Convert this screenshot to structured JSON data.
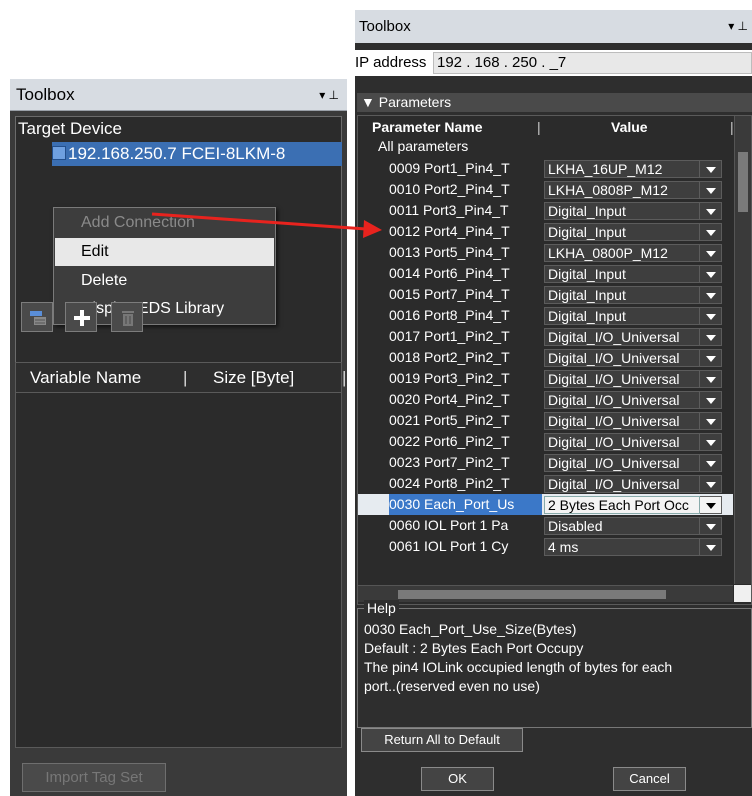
{
  "left_panel": {
    "title": "Toolbox",
    "pin_glyphs": "▾ ⊥",
    "target_label": "Target Device",
    "device": "192.168.250.7   FCEI-8LKM-8",
    "context_menu": [
      "Add Connection",
      "Edit",
      "Delete",
      "Display EDS Library"
    ],
    "variable_columns": {
      "name": "Variable Name",
      "size": "Size [Byte]",
      "sep": "|"
    },
    "import_label": "Import Tag Set"
  },
  "right_panel": {
    "title": "Toolbox",
    "pin_glyphs": "▾ ⊥",
    "ip_label": "IP address",
    "ip_value": "192 . 168 . 250 . _7",
    "params_header": "▼ Parameters",
    "col_name": "Parameter Name",
    "col_value": "Value",
    "col_sep": "|",
    "group": "All parameters",
    "rows": [
      {
        "name": "0009 Port1_Pin4_T",
        "value": "LKHA_16UP_M12"
      },
      {
        "name": "0010 Port2_Pin4_T",
        "value": "LKHA_0808P_M12"
      },
      {
        "name": "0011 Port3_Pin4_T",
        "value": "Digital_Input"
      },
      {
        "name": "0012 Port4_Pin4_T",
        "value": "Digital_Input"
      },
      {
        "name": "0013 Port5_Pin4_T",
        "value": "LKHA_0800P_M12"
      },
      {
        "name": "0014 Port6_Pin4_T",
        "value": "Digital_Input"
      },
      {
        "name": "0015 Port7_Pin4_T",
        "value": "Digital_Input"
      },
      {
        "name": "0016 Port8_Pin4_T",
        "value": "Digital_Input"
      },
      {
        "name": "0017 Port1_Pin2_T",
        "value": "Digital_I/O_Universal"
      },
      {
        "name": "0018 Port2_Pin2_T",
        "value": "Digital_I/O_Universal"
      },
      {
        "name": "0019 Port3_Pin2_T",
        "value": "Digital_I/O_Universal"
      },
      {
        "name": "0020 Port4_Pin2_T",
        "value": "Digital_I/O_Universal"
      },
      {
        "name": "0021 Port5_Pin2_T",
        "value": "Digital_I/O_Universal"
      },
      {
        "name": "0022 Port6_Pin2_T",
        "value": "Digital_I/O_Universal"
      },
      {
        "name": "0023 Port7_Pin2_T",
        "value": "Digital_I/O_Universal"
      },
      {
        "name": "0024 Port8_Pin2_T",
        "value": "Digital_I/O_Universal"
      },
      {
        "name": "0030 Each_Port_Us",
        "value": "2 Bytes Each Port Occ"
      },
      {
        "name": "0060 IOL Port 1 Pa",
        "value": "Disabled"
      },
      {
        "name": "0061 IOL Port 1 Cy",
        "value": "4 ms"
      }
    ],
    "selected_row": "0030 Each_Port_Us",
    "help_label": "Help",
    "help_lines": [
      "0030 Each_Port_Use_Size(Bytes)",
      "Default : 2 Bytes Each Port Occupy",
      "The pin4 IOLink occupied length of bytes for each",
      "port..(reserved even no use)"
    ],
    "return_label": "Return All to Default",
    "ok_label": "OK",
    "cancel_label": "Cancel"
  },
  "colors": {
    "panel_bg": "#3a3a3a",
    "title_bg": "#d7dce2",
    "selection": "#3b78c8",
    "arrow": "#e8231e"
  }
}
